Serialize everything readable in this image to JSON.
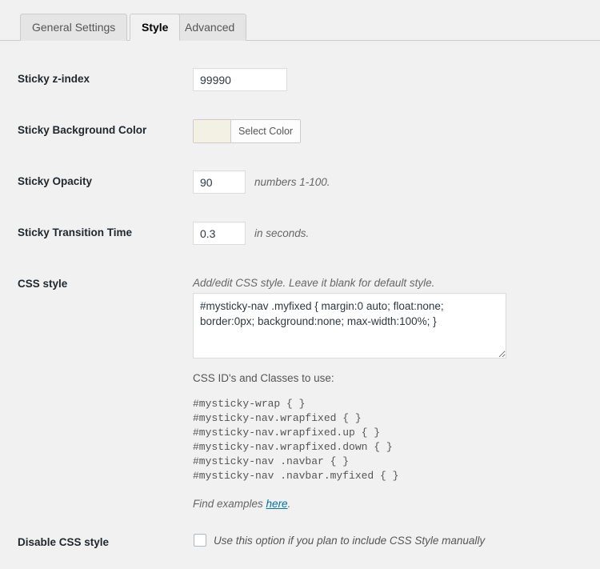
{
  "tabs": [
    {
      "label": "General Settings",
      "active": false
    },
    {
      "label": "Style",
      "active": true
    },
    {
      "label": "Advanced",
      "active": false
    }
  ],
  "fields": {
    "zindex": {
      "label": "Sticky z-index",
      "value": "99990",
      "placeholder": ""
    },
    "bgcolor": {
      "label": "Sticky Background Color",
      "button_label": "Select Color",
      "swatch_color": "#f3f1e4"
    },
    "opacity": {
      "label": "Sticky Opacity",
      "value": "90",
      "placeholder": "",
      "hint": "numbers 1-100."
    },
    "transition": {
      "label": "Sticky Transition Time",
      "value": "0.3",
      "placeholder": "",
      "hint": "in seconds."
    },
    "cssstyle": {
      "label": "CSS style",
      "description": "Add/edit CSS style. Leave it blank for default style.",
      "value": "#mysticky-nav .myfixed { margin:0 auto; float:none; border:0px; background:none; max-width:100%; }",
      "placeholder": "",
      "classes_title": "CSS ID's and Classes to use:",
      "classes_list": "#mysticky-wrap { }\n#mysticky-nav.wrapfixed { }\n#mysticky-nav.wrapfixed.up { }\n#mysticky-nav.wrapfixed.down { }\n#mysticky-nav .navbar { }\n#mysticky-nav .navbar.myfixed { }",
      "examples_prefix": "Find examples ",
      "examples_link": "here",
      "examples_suffix": "."
    },
    "disablecss": {
      "label": "Disable CSS style",
      "checkbox_label": "Use this option if you plan to include CSS Style manually",
      "checked": false
    }
  },
  "colors": {
    "page_background": "#f1f1f1",
    "link": "#0073aa",
    "label_text": "#23282d",
    "swatch": "#f3f1e4"
  }
}
